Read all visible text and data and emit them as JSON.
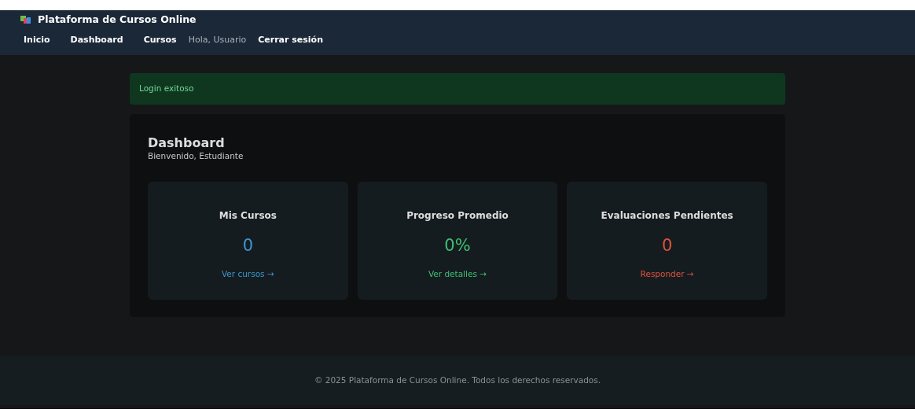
{
  "brand": {
    "title": "Plataforma de Cursos Online"
  },
  "nav": [
    {
      "label": "Inicio",
      "kind": "link"
    },
    {
      "label": "Dashboard",
      "kind": "link"
    },
    {
      "label": "Cursos",
      "kind": "link"
    },
    {
      "label": "Hola, Usuario",
      "kind": "text"
    },
    {
      "label": "Cerrar sesión",
      "kind": "link"
    }
  ],
  "alert": {
    "text": "Login exitoso"
  },
  "dashboard": {
    "title": "Dashboard",
    "subtitle": "Bienvenido, Estudiante",
    "stats": [
      {
        "title": "Mis Cursos",
        "value": "0",
        "link": "Ver cursos →",
        "color": "#3a96d2"
      },
      {
        "title": "Progreso Promedio",
        "value": "0%",
        "link": "Ver detalles →",
        "color": "#3fbf74"
      },
      {
        "title": "Evaluaciones Pendientes",
        "value": "0",
        "link": "Responder →",
        "color": "#e0513f"
      }
    ]
  },
  "footer": {
    "text": "© 2025 Plataforma de Cursos Online. Todos los derechos reservados."
  }
}
